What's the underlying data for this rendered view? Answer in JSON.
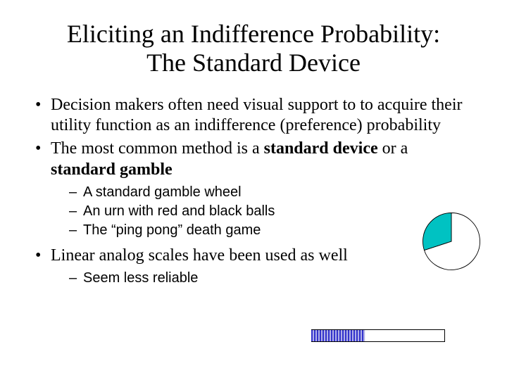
{
  "title_line1": "Eliciting an Indifference Probability:",
  "title_line2": "The Standard Device",
  "bullets": {
    "b1": "Decision makers often need visual support to to acquire their utility function as an indifference (preference) probability",
    "b2_pre": "The most common method is a ",
    "b2_bold1": "standard device",
    "b2_mid": " or a ",
    "b2_bold2": "standard gamble",
    "b2_sub1": "A standard gamble wheel",
    "b2_sub2": "An urn with red and black balls",
    "b2_sub3": "The “ping pong” death game",
    "b3": "Linear analog scales have been used as well",
    "b3_sub1": "Seem less reliable"
  },
  "chart_data": [
    {
      "type": "pie",
      "title": "",
      "categories": [
        "segment-a",
        "segment-b"
      ],
      "values": [
        70,
        30
      ],
      "colors": [
        "#ffffff",
        "#00c2c2"
      ]
    },
    {
      "type": "bar",
      "title": "",
      "categories": [
        "filled"
      ],
      "values": [
        40
      ],
      "xlim": [
        0,
        100
      ],
      "fill_color": "#3333cc",
      "hatch": "vertical-lines"
    }
  ]
}
